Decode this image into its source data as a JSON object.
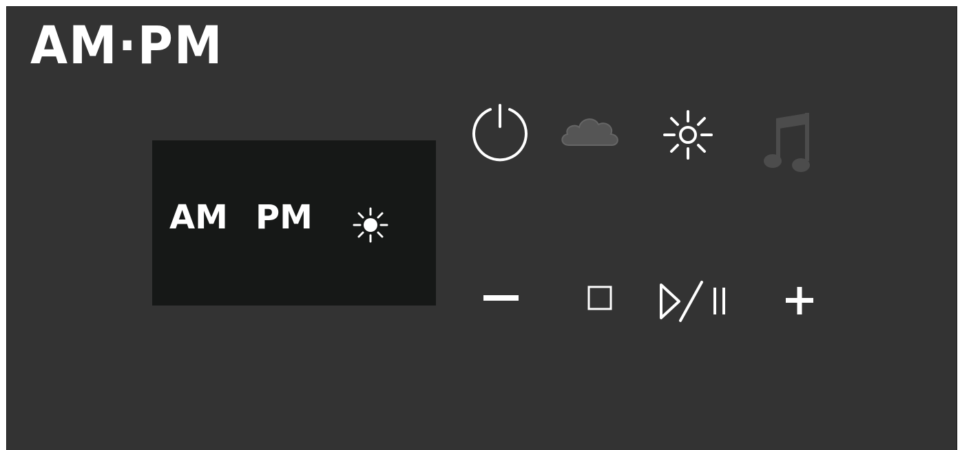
{
  "device": {
    "brand_label": "AM·PM"
  },
  "display": {
    "am_label": "AM",
    "pm_label": "PM",
    "sun_indicator_icon": "sun-icon"
  },
  "top_controls": [
    {
      "name": "power-button",
      "icon": "power-icon",
      "state": "active"
    },
    {
      "name": "cloud-button",
      "icon": "cloud-icon",
      "state": "dimmed"
    },
    {
      "name": "brightness-button",
      "icon": "sun-icon",
      "state": "active"
    },
    {
      "name": "music-button",
      "icon": "music-note-icon",
      "state": "dimmed"
    }
  ],
  "bottom_controls": [
    {
      "name": "volume-down-button",
      "icon": "minus-icon"
    },
    {
      "name": "stop-button",
      "icon": "stop-icon"
    },
    {
      "name": "play-pause-button",
      "icon": "play-pause-icon"
    },
    {
      "name": "volume-up-button",
      "icon": "plus-icon"
    }
  ],
  "colors": {
    "panel": "#333333",
    "screen": "#161817",
    "active_icon": "#ffffff",
    "dimmed_icon": "#555555"
  }
}
